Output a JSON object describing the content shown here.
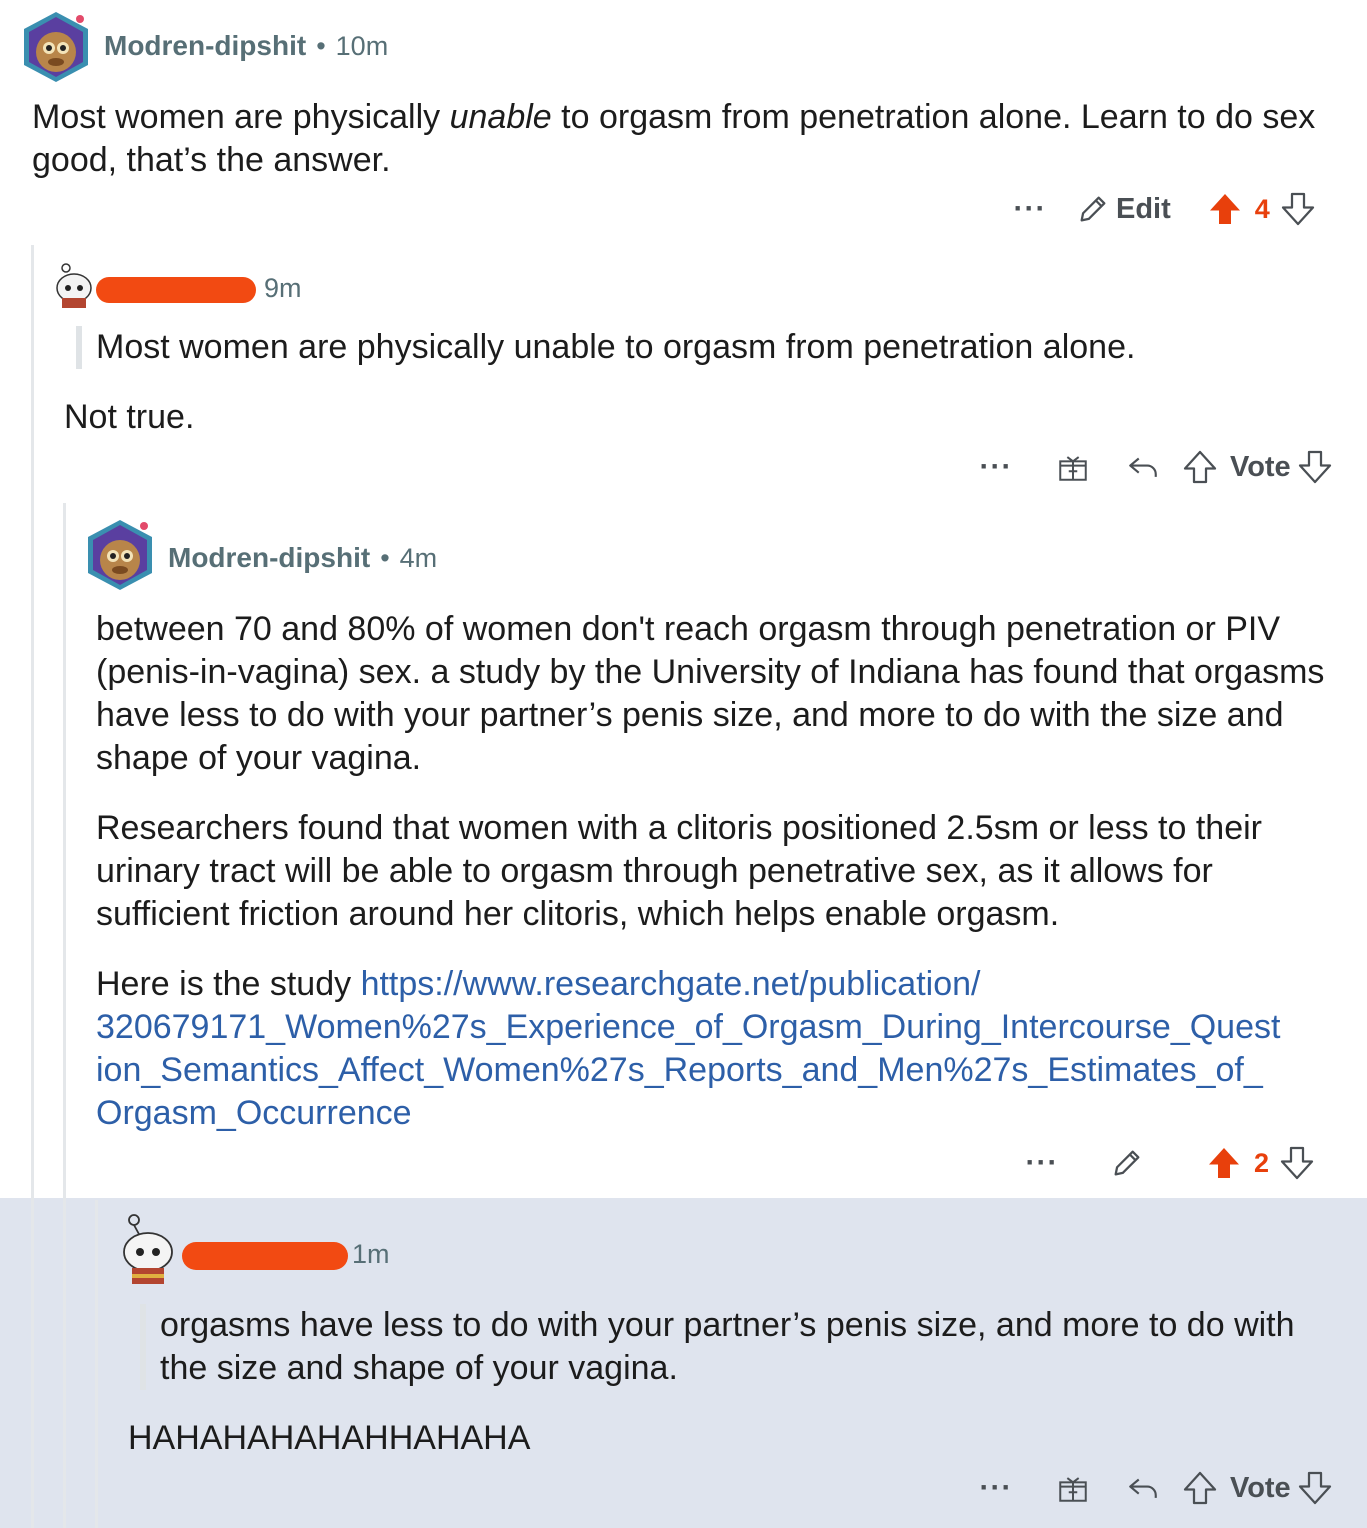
{
  "comments": [
    {
      "username": "Modren-dipshit",
      "separator": "•",
      "time": "10m",
      "text_before": "Most women are physically ",
      "text_emphasis": "unable",
      "text_after": " to orgasm from penetration alone. Learn to do sex good, that’s the answer.",
      "actions": {
        "more": "···",
        "edit": "Edit",
        "score": "4"
      }
    },
    {
      "username_redacted": true,
      "time": "9m",
      "quote": "Most women are physically unable to orgasm from penetration alone.",
      "text": "Not true.",
      "actions": {
        "more": "···",
        "vote": "Vote"
      }
    },
    {
      "username": "Modren-dipshit",
      "separator": "•",
      "time": "4m",
      "paragraph_1": "between 70 and 80% of women don't reach orgasm through penetration or PIV (penis-in-vagina) sex. a study by the University of Indiana has found that orgasms have less to do with your partner’s penis size, and more to do with the size and shape of your vagina.",
      "paragraph_2": "Researchers found that women with a clitoris positioned 2.5sm or less to their urinary tract will be able to orgasm through penetrative sex, as it allows for sufficient friction around her clitoris, which helps enable orgasm.",
      "paragraph_3_prefix": "Here is the study ",
      "link_line_1": "https://www.researchgate.net/publication/",
      "link_line_2": "320679171_Women%27s_Experience_of_Orgasm_During_Intercourse_Quest",
      "link_line_3": "ion_Semantics_Affect_Women%27s_Reports_and_Men%27s_Estimates_of_",
      "link_line_4": "Orgasm_Occurrence",
      "actions": {
        "more": "···",
        "score": "2"
      }
    },
    {
      "username_redacted": true,
      "time": "1m",
      "quote": "orgasms have less to do with your partner’s penis size, and more to do with the size and shape of your vagina.",
      "text": "HAHAHAHAHAHHAHAHA",
      "actions": {
        "more": "···",
        "vote": "Vote"
      }
    }
  ],
  "colors": {
    "upvoted": "#e8400c",
    "link": "#2d5fa8",
    "meta": "#576f76",
    "redaction": "#f24a12",
    "highlight": "#dfe4ee"
  },
  "icons": [
    "avatar-snoo-icon",
    "pencil-icon",
    "upvote-filled-icon",
    "downvote-icon",
    "upvote-icon",
    "award-icon",
    "reply-icon"
  ]
}
